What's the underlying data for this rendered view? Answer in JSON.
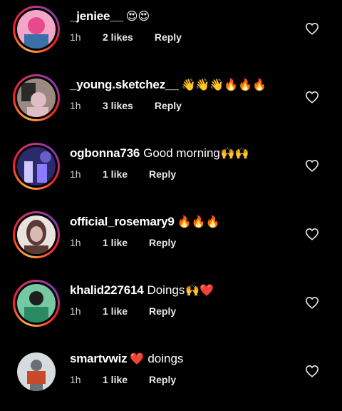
{
  "comments": [
    {
      "username": "_jeniee__",
      "text": "",
      "emoji": "😍😍",
      "time": "1h",
      "likes": "2 likes",
      "reply": "Reply",
      "story_ring": true,
      "avatar_colors": [
        "#e64a8c",
        "#f3a6c8",
        "#3a6fa8"
      ]
    },
    {
      "username": "_young.sketchez__",
      "text": "",
      "emoji": "👋👋👋🔥🔥🔥",
      "time": "1h",
      "likes": "3 likes",
      "reply": "Reply",
      "story_ring": true,
      "avatar_colors": [
        "#9a8a80",
        "#e0bcc4",
        "#2a2a2a"
      ]
    },
    {
      "username": "ogbonna736",
      "text": "Good morning",
      "emoji": "🙌🙌",
      "time": "1h",
      "likes": "1 like",
      "reply": "Reply",
      "story_ring": true,
      "avatar_colors": [
        "#2b2a6a",
        "#6b5cc9",
        "#cfc8ff"
      ]
    },
    {
      "username": "official_rosemary9",
      "text": "",
      "emoji": "🔥🔥🔥",
      "time": "1h",
      "likes": "1 like",
      "reply": "Reply",
      "story_ring": true,
      "avatar_colors": [
        "#5a3a34",
        "#d9b9b2",
        "#e9e2de"
      ]
    },
    {
      "username": "khalid227614",
      "text": "Doings",
      "emoji": "🙌❤️",
      "time": "1h",
      "likes": "1 like",
      "reply": "Reply",
      "story_ring": true,
      "avatar_colors": [
        "#2a8a62",
        "#74c9a3",
        "#1e1e1e"
      ]
    },
    {
      "username": "smartvwiz",
      "text": "doings",
      "emoji": "❤️",
      "emoji_before_text": true,
      "time": "1h",
      "likes": "1 like",
      "reply": "Reply",
      "story_ring": false,
      "avatar_colors": [
        "#d7dbe0",
        "#c94a2a",
        "#6a6f78"
      ]
    }
  ],
  "icons": {
    "like": "heart-outline-icon"
  }
}
